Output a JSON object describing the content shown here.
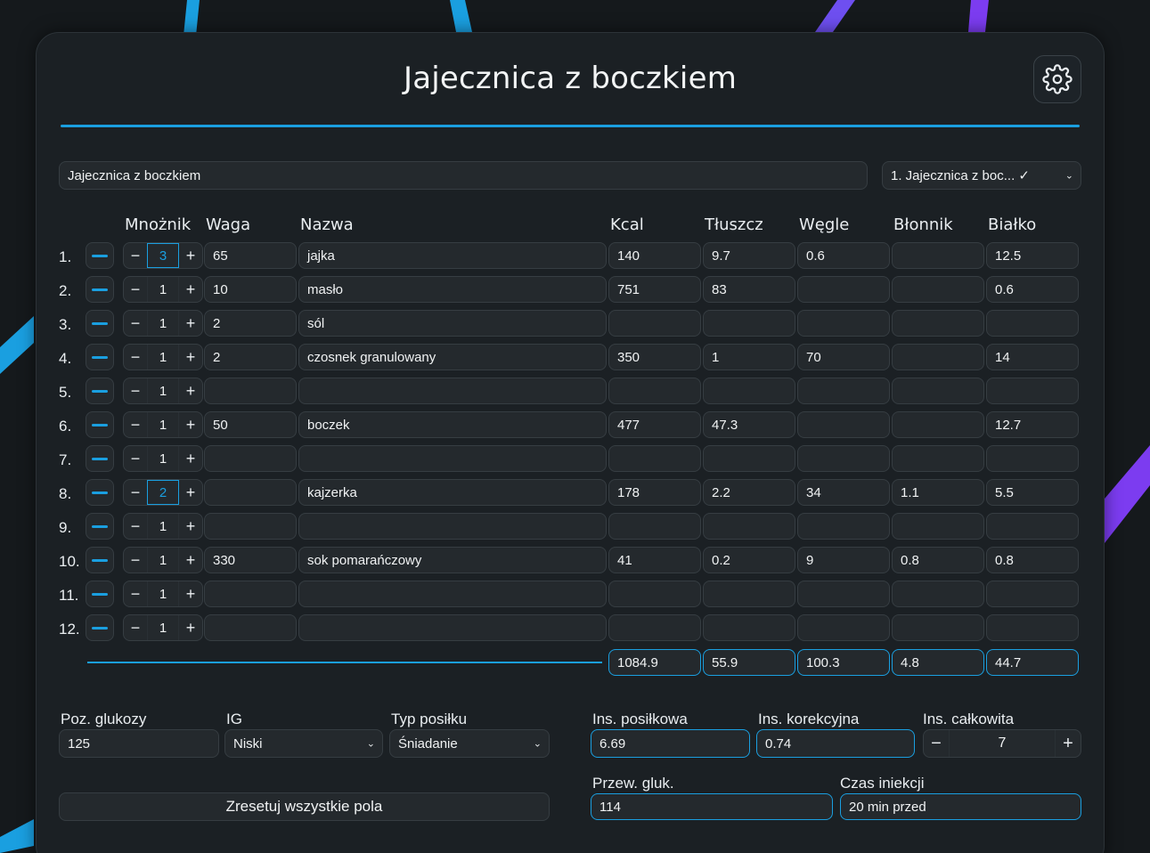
{
  "header": {
    "title": "Jajecznica z boczkiem"
  },
  "colors": {
    "accent": "#1a9fe0",
    "violet": "#7c3cf0"
  },
  "meal": {
    "name": "Jajecznica z boczkiem",
    "selected": "1. Jajecznica z boc... ✓"
  },
  "columns": {
    "multiplier": "Mnożnik",
    "weight": "Waga",
    "name": "Nazwa",
    "kcal": "Kcal",
    "fat": "Tłuszcz",
    "carbs": "Węgle",
    "fiber": "Błonnik",
    "protein": "Białko"
  },
  "rows": [
    {
      "num": "1.",
      "mult": "3",
      "weight": "65",
      "name": "jajka",
      "kcal": "140",
      "fat": "9.7",
      "carbs": "0.6",
      "fiber": "",
      "protein": "12.5"
    },
    {
      "num": "2.",
      "mult": "1",
      "weight": "10",
      "name": "masło",
      "kcal": "751",
      "fat": "83",
      "carbs": "",
      "fiber": "",
      "protein": "0.6"
    },
    {
      "num": "3.",
      "mult": "1",
      "weight": "2",
      "name": "sól",
      "kcal": "",
      "fat": "",
      "carbs": "",
      "fiber": "",
      "protein": ""
    },
    {
      "num": "4.",
      "mult": "1",
      "weight": "2",
      "name": "czosnek granulowany",
      "kcal": "350",
      "fat": "1",
      "carbs": "70",
      "fiber": "",
      "protein": "14"
    },
    {
      "num": "5.",
      "mult": "1",
      "weight": "",
      "name": "",
      "kcal": "",
      "fat": "",
      "carbs": "",
      "fiber": "",
      "protein": ""
    },
    {
      "num": "6.",
      "mult": "1",
      "weight": "50",
      "name": "boczek",
      "kcal": "477",
      "fat": "47.3",
      "carbs": "",
      "fiber": "",
      "protein": "12.7"
    },
    {
      "num": "7.",
      "mult": "1",
      "weight": "",
      "name": "",
      "kcal": "",
      "fat": "",
      "carbs": "",
      "fiber": "",
      "protein": ""
    },
    {
      "num": "8.",
      "mult": "2",
      "weight": "",
      "name": "kajzerka",
      "kcal": "178",
      "fat": "2.2",
      "carbs": "34",
      "fiber": "1.1",
      "protein": "5.5"
    },
    {
      "num": "9.",
      "mult": "1",
      "weight": "",
      "name": "",
      "kcal": "",
      "fat": "",
      "carbs": "",
      "fiber": "",
      "protein": ""
    },
    {
      "num": "10.",
      "mult": "1",
      "weight": "330",
      "name": "sok pomarańczowy",
      "kcal": "41",
      "fat": "0.2",
      "carbs": "9",
      "fiber": "0.8",
      "protein": "0.8"
    },
    {
      "num": "11.",
      "mult": "1",
      "weight": "",
      "name": "",
      "kcal": "",
      "fat": "",
      "carbs": "",
      "fiber": "",
      "protein": ""
    },
    {
      "num": "12.",
      "mult": "1",
      "weight": "",
      "name": "",
      "kcal": "",
      "fat": "",
      "carbs": "",
      "fiber": "",
      "protein": ""
    }
  ],
  "totals": {
    "kcal": "1084.9",
    "fat": "55.9",
    "carbs": "100.3",
    "fiber": "4.8",
    "protein": "44.7"
  },
  "bottom": {
    "glucose_label": "Poz. glukozy",
    "glucose_value": "125",
    "ig_label": "IG",
    "ig_value": "Niski",
    "meal_type_label": "Typ posiłku",
    "meal_type_value": "Śniadanie",
    "reset_label": "Zresetuj wszystkie pola",
    "ins_meal_label": "Ins. posiłkowa",
    "ins_meal_value": "6.69",
    "ins_corr_label": "Ins. korekcyjna",
    "ins_corr_value": "0.74",
    "ins_total_label": "Ins. całkowita",
    "ins_total_value": "7",
    "pred_gluc_label": "Przew. gluk.",
    "pred_gluc_value": "114",
    "inj_time_label": "Czas iniekcji",
    "inj_time_value": "20 min przed"
  },
  "icons": {
    "settings": "gear-icon",
    "remove_row": "minus-icon",
    "select": "chevron-down-icon"
  },
  "symbols": {
    "minus": "−",
    "plus": "+",
    "chevron": "⌄"
  }
}
